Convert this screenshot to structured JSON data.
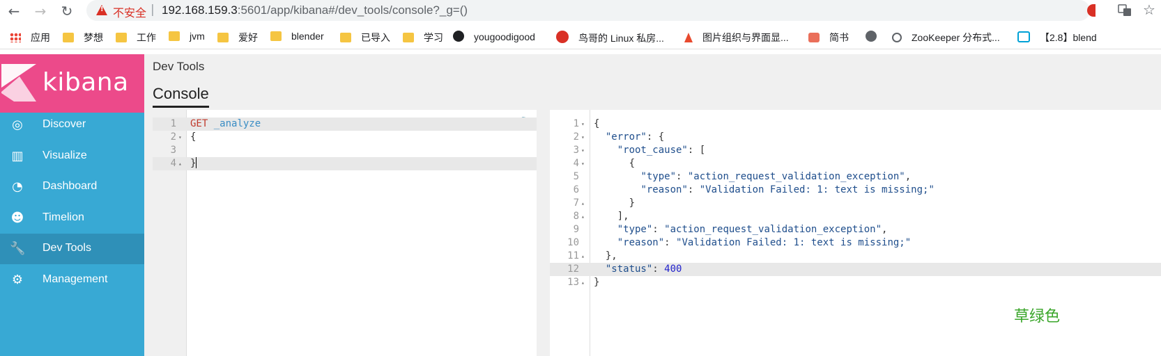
{
  "browser": {
    "back": "←",
    "forward": "→",
    "reload": "↻",
    "insecure_label": "不安全",
    "separator": "|",
    "url_host": "192.168.159.3",
    "url_path": ":5601/app/kibana#/dev_tools/console?_g=()",
    "translate_icon": "translate-icon",
    "star": "☆"
  },
  "bookmarks": [
    {
      "label": "应用",
      "icon": "apps-grid-icon"
    },
    {
      "label": "梦想",
      "icon": "folder-icon"
    },
    {
      "label": "工作",
      "icon": "folder-icon"
    },
    {
      "label": "jvm",
      "icon": "folder-icon"
    },
    {
      "label": "爱好",
      "icon": "folder-icon"
    },
    {
      "label": "blender",
      "icon": "folder-icon"
    },
    {
      "label": "已导入",
      "icon": "folder-icon"
    },
    {
      "label": "学习",
      "icon": "folder-icon"
    },
    {
      "label": "yougoodigood",
      "icon": "github-icon"
    },
    {
      "label": "鸟哥的 Linux 私房...",
      "icon": "p-icon"
    },
    {
      "label": "图片组织与界面显...",
      "icon": "flame-icon"
    },
    {
      "label": "简书",
      "icon": "jianshu-icon"
    },
    {
      "label": "",
      "icon": "globe-icon"
    },
    {
      "label": "ZooKeeper 分布式...",
      "icon": "zookeeper-icon"
    },
    {
      "label": "【2.8】blend",
      "icon": "bilibili-icon"
    }
  ],
  "sidebar": {
    "brand": "kibana",
    "items": [
      {
        "label": "Discover",
        "icon": "compass-icon",
        "glyph": "◎"
      },
      {
        "label": "Visualize",
        "icon": "bar-chart-icon",
        "glyph": "▥"
      },
      {
        "label": "Dashboard",
        "icon": "gauge-icon",
        "glyph": "◔"
      },
      {
        "label": "Timelion",
        "icon": "bear-icon",
        "glyph": "☻"
      },
      {
        "label": "Dev Tools",
        "icon": "wrench-icon",
        "glyph": "🔧"
      },
      {
        "label": "Management",
        "icon": "gear-icon",
        "glyph": "⚙"
      }
    ],
    "active": "Dev Tools"
  },
  "main": {
    "title": "Dev Tools",
    "tab": "Console"
  },
  "editor": {
    "lines": [
      {
        "n": "1",
        "fold": "",
        "method": "GET",
        "path": " _analyze",
        "text": ""
      },
      {
        "n": "2",
        "fold": "▾",
        "method": "",
        "path": "",
        "text": "{"
      },
      {
        "n": "3",
        "fold": "",
        "method": "",
        "path": "",
        "text": ""
      },
      {
        "n": "4",
        "fold": "▴",
        "method": "",
        "path": "",
        "text": "}"
      }
    ]
  },
  "output": {
    "lines": [
      {
        "n": "1",
        "fold": "▾",
        "text": "{"
      },
      {
        "n": "2",
        "fold": "▾",
        "text": "  \"error\": {"
      },
      {
        "n": "3",
        "fold": "▾",
        "text": "    \"root_cause\": ["
      },
      {
        "n": "4",
        "fold": "▾",
        "text": "      {"
      },
      {
        "n": "5",
        "fold": "",
        "text": "        \"type\": \"action_request_validation_exception\","
      },
      {
        "n": "6",
        "fold": "",
        "text": "        \"reason\": \"Validation Failed: 1: text is missing;\""
      },
      {
        "n": "7",
        "fold": "▴",
        "text": "      }"
      },
      {
        "n": "8",
        "fold": "▴",
        "text": "    ],"
      },
      {
        "n": "9",
        "fold": "",
        "text": "    \"type\": \"action_request_validation_exception\","
      },
      {
        "n": "10",
        "fold": "",
        "text": "    \"reason\": \"Validation Failed: 1: text is missing;\""
      },
      {
        "n": "11",
        "fold": "▴",
        "text": "  },"
      },
      {
        "n": "12",
        "fold": "",
        "text": "  \"status\": 400"
      },
      {
        "n": "13",
        "fold": "▴",
        "text": "}"
      }
    ]
  },
  "watermark": "草绿色",
  "colors": {
    "kibana_pink": "#ec4a8a",
    "sidebar_blue": "#38a9d4",
    "sidebar_active": "#2f90b8",
    "run_green": "#28a745",
    "watermark_green": "#3aa62a"
  }
}
